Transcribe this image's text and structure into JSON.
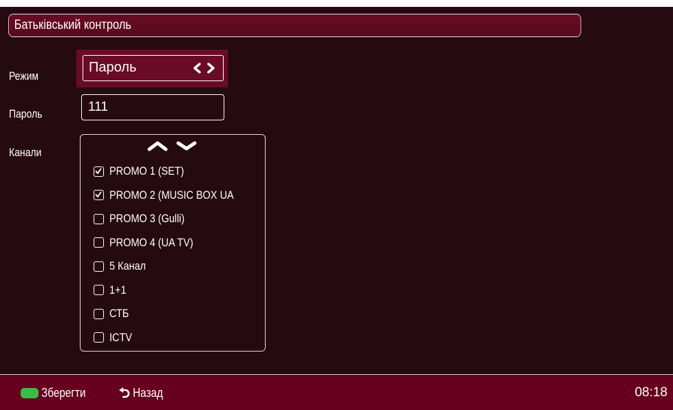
{
  "header": {
    "title": "Батьківський контроль"
  },
  "mode": {
    "label": "Режим",
    "value": "Пароль",
    "arrows_icon": "left-right-chevrons"
  },
  "password": {
    "label": "Пароль",
    "value": "111"
  },
  "channels": {
    "label": "Канали",
    "scroll_icons": [
      "chevron-up",
      "chevron-down"
    ],
    "items": [
      {
        "name": "PROMO 1 (SET)",
        "checked": true
      },
      {
        "name": "PROMO 2 (MUSIC BOX UA",
        "checked": true
      },
      {
        "name": "PROMO 3 (Gulli)",
        "checked": false
      },
      {
        "name": "PROMO 4 (UA TV)",
        "checked": false
      },
      {
        "name": "5 Канал",
        "checked": false
      },
      {
        "name": "1+1",
        "checked": false
      },
      {
        "name": "СТБ",
        "checked": false
      },
      {
        "name": "ICTV",
        "checked": false
      }
    ]
  },
  "footer": {
    "save_label": "Зберегти",
    "back_label": "Назад",
    "clock": "08:18"
  },
  "colors": {
    "background": "#260a12",
    "header_bar": "#600a22",
    "footer_bar": "#66001e",
    "focus": "#6a0b27",
    "green_key": "#3dba48"
  }
}
